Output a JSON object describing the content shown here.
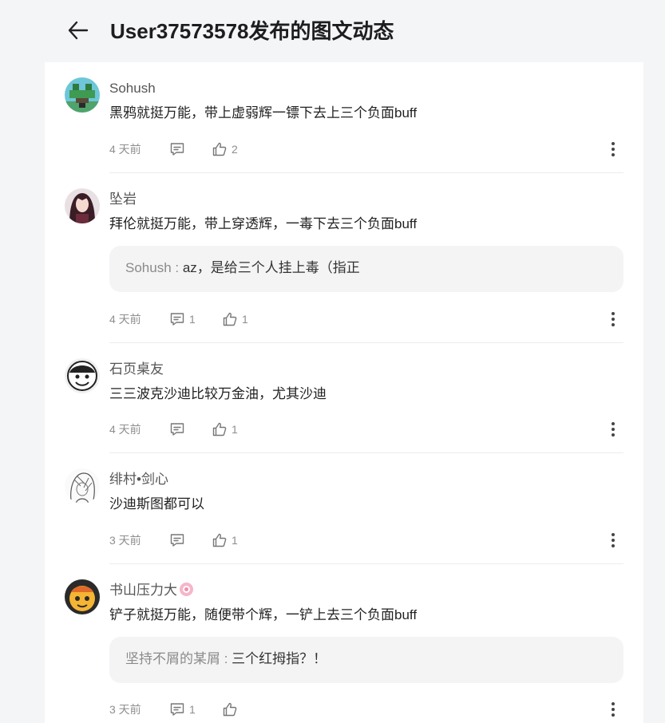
{
  "header": {
    "title": "User37573578发布的图文动态"
  },
  "comments": [
    {
      "user": "Sohush",
      "text": "黑鸦就挺万能，带上虚弱辉一镖下去上三个负面buff",
      "time": "4 天前",
      "reply_count": "",
      "like_count": "2"
    },
    {
      "user": "坠岩",
      "text": "拜伦就挺万能，带上穿透辉，一毒下去三个负面buff",
      "reply": {
        "user": "Sohush : ",
        "text": "az，是给三个人挂上毒（指正"
      },
      "time": "4 天前",
      "reply_count": "1",
      "like_count": "1"
    },
    {
      "user": "石页桌友",
      "text": "三三波克沙迪比较万金油，尤其沙迪",
      "time": "4 天前",
      "reply_count": "",
      "like_count": "1"
    },
    {
      "user": "绯村•剑心",
      "text": "沙迪斯图都可以",
      "time": "3 天前",
      "reply_count": "",
      "like_count": "1"
    },
    {
      "user": "书山压力大",
      "text": "铲子就挺万能，随便带个辉，一铲上去三个负面buff",
      "reply": {
        "user": "坚持不屑的某屑 : ",
        "text": "三个红拇指？！"
      },
      "time": "3 天前",
      "reply_count": "1",
      "like_count": ""
    }
  ]
}
